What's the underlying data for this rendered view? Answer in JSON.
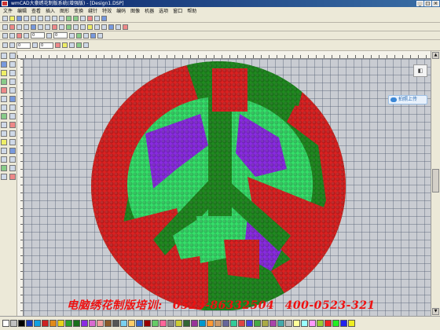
{
  "window": {
    "title": "wmCAD大豪绣花制版系统(增强版) - [Design1.DSP]",
    "buttons": [
      "_",
      "□",
      "×"
    ]
  },
  "menu": [
    "文件",
    "编辑",
    "查看",
    "插入",
    "图形",
    "变换",
    "缝针",
    "特效",
    "编码",
    "图像",
    "机器",
    "选项",
    "窗口",
    "帮助"
  ],
  "toolbar": {
    "size_value_1": "0",
    "size_value_2": "0",
    "size_value_3": "0",
    "size_value_4": "0"
  },
  "canvas": {
    "colors": {
      "red": "#dc2121",
      "green": "#1f8a1f",
      "light_green": "#35e06a",
      "purple": "#8a2be2",
      "background": "#c9ccd2"
    },
    "stitch_pattern": "peace-sign"
  },
  "widgets": {
    "upload_label": "拍照上传",
    "mini_panel_icon": "collapse-icon"
  },
  "banner": {
    "text": "电脑绣花制版培训:",
    "phone1": "0523-86332504",
    "phone2": "400-0523-321"
  },
  "palette": [
    "#ffffff",
    "#c0c0c0",
    "#000000",
    "#1a3ab8",
    "#11a0e0",
    "#cc2222",
    "#e08a1a",
    "#e6d21a",
    "#2aa02a",
    "#1a6e1a",
    "#8a2be2",
    "#d86bd0",
    "#f0a0a0",
    "#8a5a2a",
    "#555555",
    "#7ad0f0",
    "#ffcc66",
    "#3366cc",
    "#990000",
    "#66cc66",
    "#ff6699",
    "#888888",
    "#cccc33",
    "#336633",
    "#993399",
    "#0099cc",
    "#ff9933",
    "#cc9966",
    "#666699",
    "#33cc99",
    "#dd4444",
    "#4444dd",
    "#44aa44",
    "#aaaa44",
    "#aa44aa",
    "#44aaaa",
    "#bbbbbb",
    "#ffff99",
    "#99ffff",
    "#ff99ff",
    "#99cc33",
    "#ee2222",
    "#22ee22",
    "#2222ee",
    "#eeee22"
  ]
}
